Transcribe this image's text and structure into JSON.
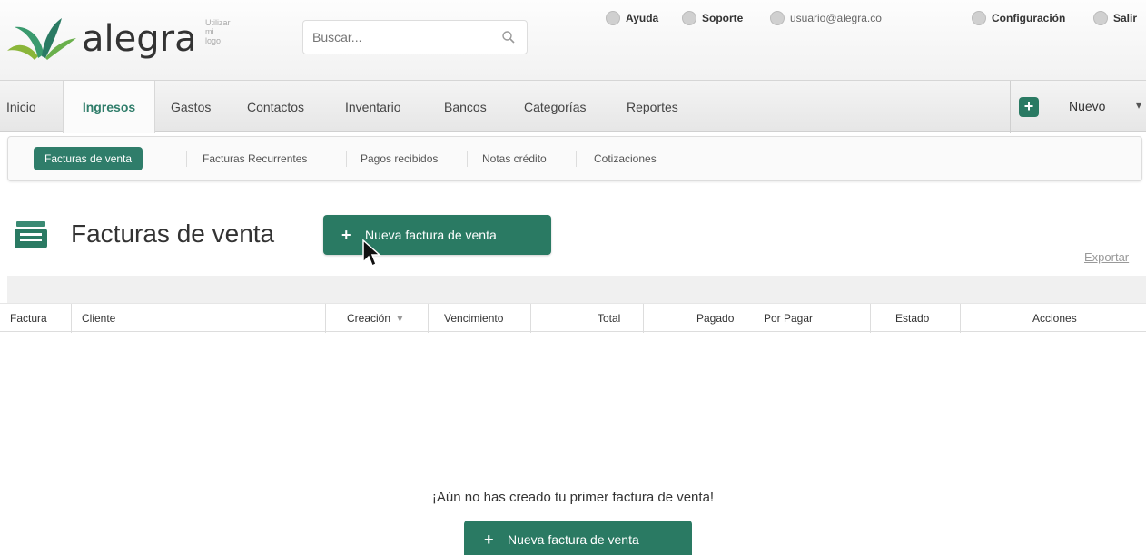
{
  "header": {
    "logo_text": "alegra",
    "logo_subtext": "Utilizar mi logo",
    "search_placeholder": "Buscar...",
    "links": {
      "ayuda": "Ayuda",
      "soporte": "Soporte",
      "user": "usuario@alegra.co",
      "config": "Configuración",
      "salir": "Salir"
    }
  },
  "nav": {
    "items": [
      "Inicio",
      "Ingresos",
      "Gastos",
      "Contactos",
      "Inventario",
      "Bancos",
      "Categorías",
      "Reportes"
    ],
    "active": "Ingresos",
    "nuevo_label": "Nuevo"
  },
  "subnav": {
    "items": [
      "Facturas de venta",
      "Facturas Recurrentes",
      "Pagos recibidos",
      "Notas crédito",
      "Cotizaciones"
    ],
    "active": "Facturas de venta"
  },
  "page": {
    "title": "Facturas de venta",
    "new_button": "Nueva factura de venta",
    "export_link": "Exportar"
  },
  "table": {
    "columns": [
      "Factura",
      "Cliente",
      "Creación",
      "Vencimiento",
      "Total",
      "Pagado",
      "Por Pagar",
      "Estado",
      "Acciones"
    ],
    "sort_indicator": "▾"
  },
  "empty": {
    "message": "¡Aún no has creado tu primer factura de venta!",
    "button": "Nueva factura de venta"
  },
  "colors": {
    "accent": "#2a7a63",
    "active_tab_text": "#2f7d6a"
  }
}
